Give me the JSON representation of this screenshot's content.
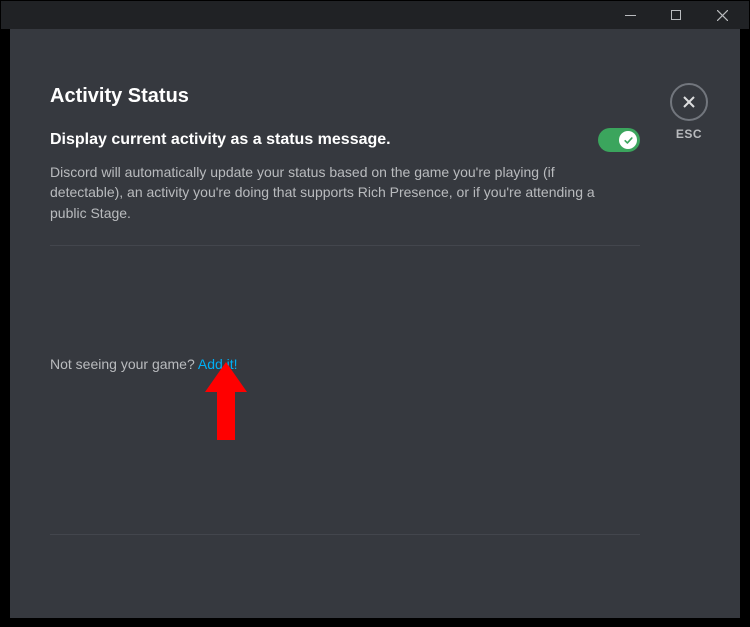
{
  "page": {
    "title": "Activity Status"
  },
  "setting": {
    "label": "Display current activity as a status message.",
    "description": "Discord will automatically update your status based on the game you're playing (if detectable), an activity you're doing that supports Rich Presence, or if you're attending a public Stage.",
    "enabled": true
  },
  "gamePrompt": {
    "text": "Not seeing your game? ",
    "linkText": "Add it!"
  },
  "close": {
    "label": "ESC"
  }
}
